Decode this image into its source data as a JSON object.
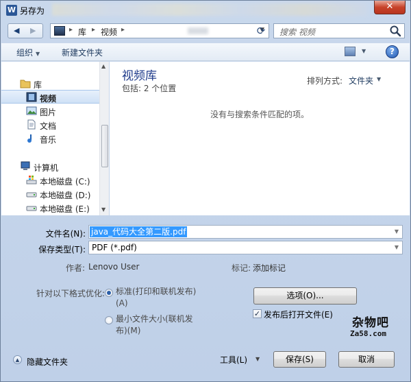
{
  "window": {
    "title": "另存为",
    "app_icon": "W",
    "close_glyph": "✕"
  },
  "nav": {
    "back_glyph": "◀",
    "forward_glyph": "▶"
  },
  "address": {
    "segments": [
      "库",
      "视频"
    ],
    "separator": "▸",
    "dropdown_glyph": "▼",
    "refresh_glyph": "⟳"
  },
  "search": {
    "placeholder": "搜索 视频"
  },
  "toolbar": {
    "organize_label": "组织",
    "new_folder_label": "新建文件夹",
    "help_glyph": "?"
  },
  "sidebar": {
    "items": [
      {
        "label": "库",
        "icon": "library-icon"
      },
      {
        "label": "视频",
        "icon": "video-library-icon",
        "selected": true
      },
      {
        "label": "图片",
        "icon": "pictures-icon"
      },
      {
        "label": "文档",
        "icon": "documents-icon"
      },
      {
        "label": "音乐",
        "icon": "music-icon"
      },
      {
        "label": "计算机",
        "icon": "computer-icon"
      },
      {
        "label": "本地磁盘 (C:)",
        "icon": "system-drive-icon"
      },
      {
        "label": "本地磁盘 (D:)",
        "icon": "drive-icon"
      },
      {
        "label": "本地磁盘 (E:)",
        "icon": "drive-icon"
      }
    ]
  },
  "content": {
    "library_title": "视频库",
    "library_subtitle": "包括: 2 个位置",
    "sort_label": "排列方式:",
    "sort_value": "文件夹",
    "empty_message": "没有与搜索条件匹配的项。"
  },
  "form": {
    "filename_label": "文件名(N):",
    "filename_value": "java_代码大全第二版.pdf",
    "filetype_label": "保存类型(T):",
    "filetype_value": "PDF (*.pdf)",
    "author_label": "作者:",
    "author_value": "Lenovo User",
    "tags_label": "标记:",
    "tags_value": "添加标记",
    "optimize_label": "针对以下格式优化:",
    "radio_standard": "标准(打印和联机发布)",
    "radio_standard_key": "(A)",
    "radio_minimum": "最小文件大小(联机发",
    "radio_minimum_2": "布)(M)",
    "options_button": "选项(O)...",
    "open_after_publish": "发布后打开文件(E)"
  },
  "footer": {
    "hide_folders": "隐藏文件夹",
    "tools_label": "工具(L)",
    "save_button": "保存(S)",
    "cancel_button": "取消"
  },
  "watermark": {
    "line1": "杂物吧",
    "line2": "Za58.com"
  }
}
